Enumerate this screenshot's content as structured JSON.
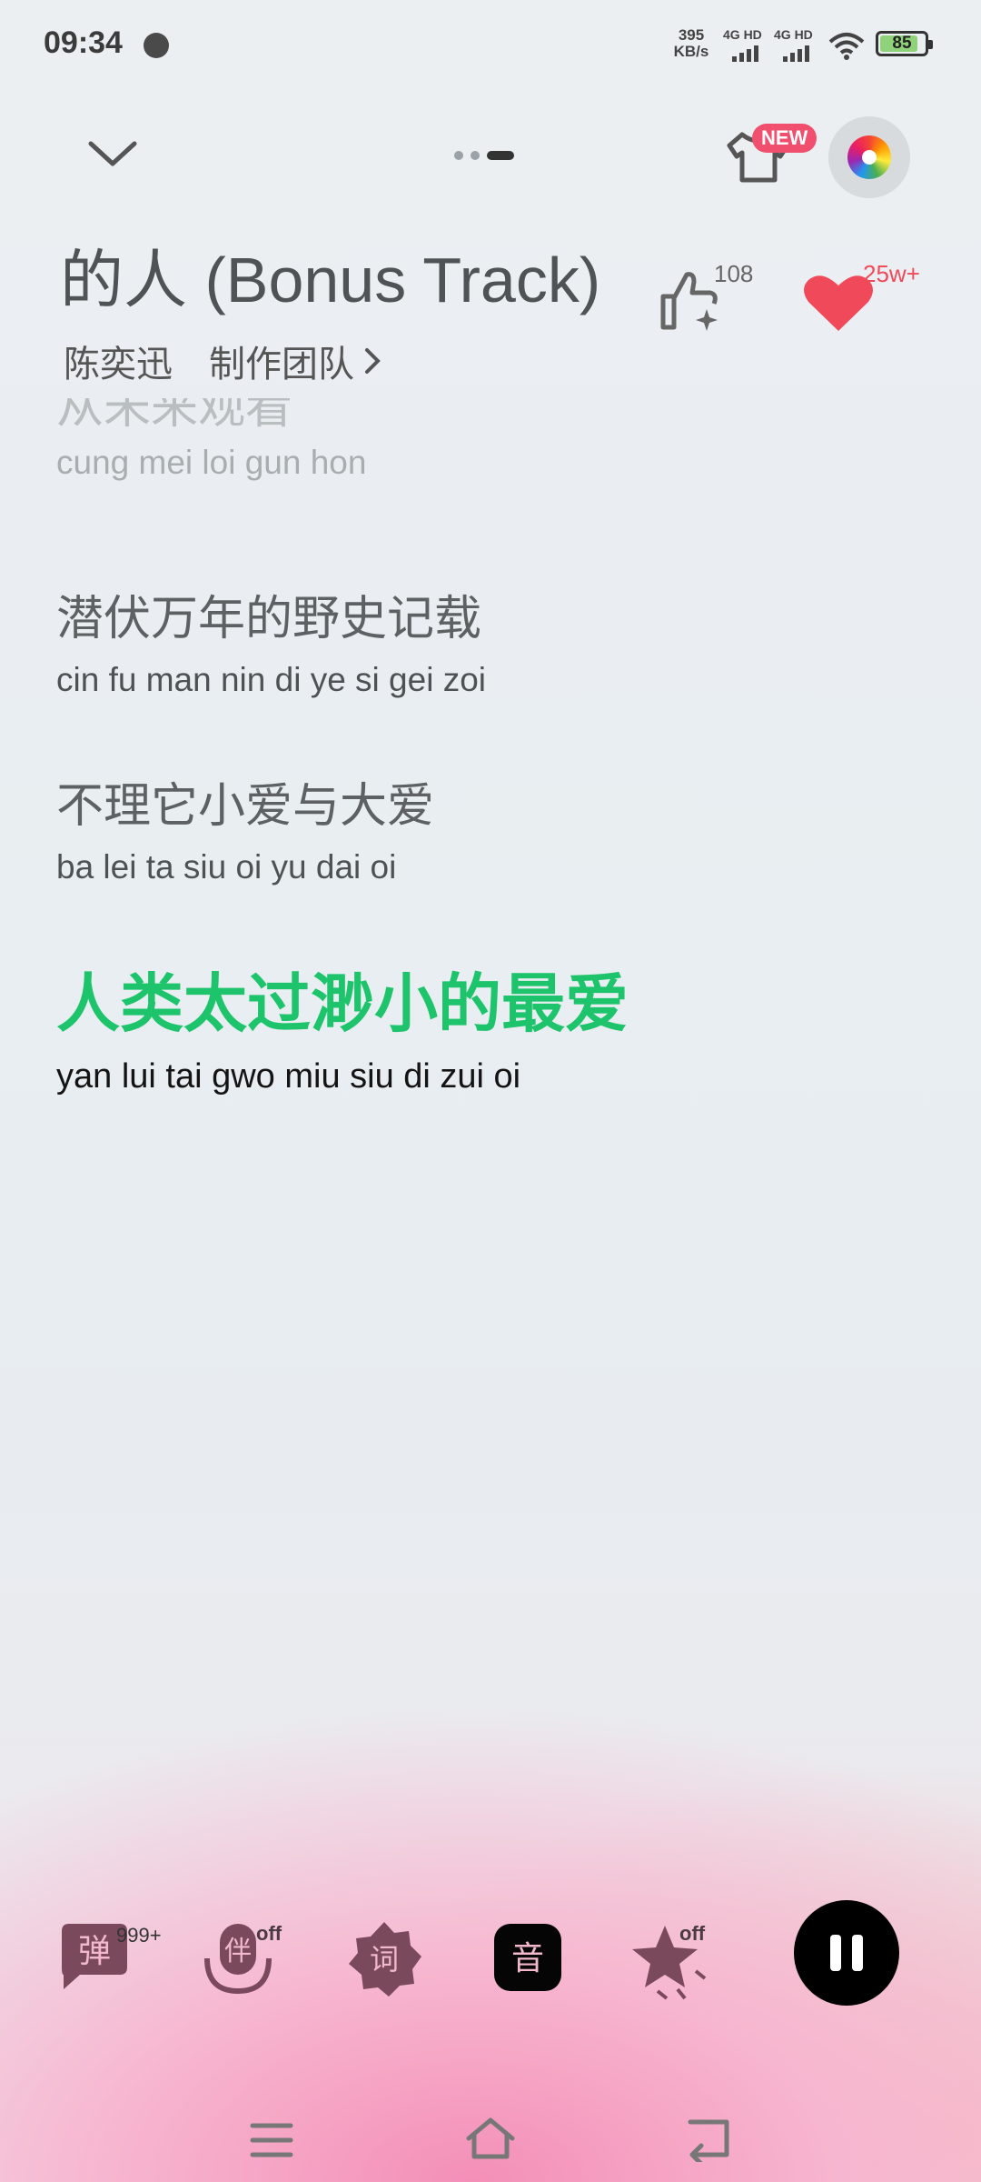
{
  "status": {
    "time": "09:34",
    "net_speed_value": "395",
    "net_speed_unit": "KB/s",
    "sim1_label": "4G HD",
    "sim2_label": "4G HD",
    "battery": "85"
  },
  "header": {
    "skin_badge": "NEW"
  },
  "song": {
    "title": "的人 (Bonus Track)",
    "artist": "陈奕迅",
    "credits_label": "制作团队",
    "like_count": "108",
    "favorite_count": "25w+"
  },
  "lyrics": [
    {
      "cn": "从未来观看",
      "rom": "cung mei loi gun hon",
      "state": "faded"
    },
    {
      "cn": "潜伏万年的野史记载",
      "rom": "cin fu man nin di ye si gei zoi",
      "state": "normal"
    },
    {
      "cn": "不理它小爱与大爱",
      "rom": "ba lei ta siu oi yu dai oi",
      "state": "normal"
    },
    {
      "cn": "人类太过渺小的最爱",
      "rom": "yan lui tai gwo miu siu di zui oi",
      "state": "current"
    }
  ],
  "toolbar": {
    "danmu_label": "弹",
    "danmu_count": "999+",
    "accompany_label": "伴",
    "accompany_state": "off",
    "lyrics_label": "词",
    "sound_label": "音",
    "effects_state": "off"
  },
  "colors": {
    "current_lyric": "#1ec46b",
    "favorite": "#f04a5a",
    "badge": "#f0506e"
  }
}
